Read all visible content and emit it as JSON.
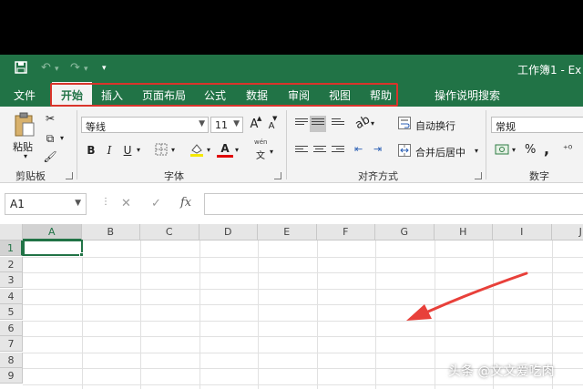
{
  "window": {
    "title": "工作簿1  -  Ex"
  },
  "quick_access": {
    "save_icon": "save-icon",
    "undo_icon": "undo-icon",
    "redo_icon": "redo-icon",
    "customize_icon": "customize-qat-icon"
  },
  "tabs": [
    {
      "label": "文件",
      "active": false
    },
    {
      "label": "开始",
      "active": true
    },
    {
      "label": "插入",
      "active": false
    },
    {
      "label": "页面布局",
      "active": false
    },
    {
      "label": "公式",
      "active": false
    },
    {
      "label": "数据",
      "active": false
    },
    {
      "label": "审阅",
      "active": false
    },
    {
      "label": "视图",
      "active": false
    },
    {
      "label": "帮助",
      "active": false
    }
  ],
  "tell_me": {
    "label": "操作说明搜索",
    "icon": "lightbulb-icon"
  },
  "ribbon": {
    "clipboard": {
      "paste_label": "粘贴",
      "group_label": "剪贴板"
    },
    "font": {
      "font_name": "等线",
      "font_size": "11",
      "bold": "B",
      "italic": "I",
      "underline": "U",
      "grow": "A",
      "shrink": "A",
      "phonetic_top": "wén",
      "phonetic_bottom": "文",
      "font_color_letter": "A",
      "group_label": "字体"
    },
    "alignment": {
      "wrap_text": "自动换行",
      "merge_center": "合并后居中",
      "group_label": "对齐方式"
    },
    "number": {
      "format": "常规",
      "percent": "%",
      "comma": ",",
      "group_label": "数字"
    }
  },
  "formula_bar": {
    "name_box": "A1",
    "cancel": "✕",
    "enter": "✓",
    "fx": "fx",
    "formula": ""
  },
  "grid": {
    "columns": [
      "A",
      "B",
      "C",
      "D",
      "E",
      "F",
      "G",
      "H",
      "I",
      "J"
    ],
    "rows": [
      "1",
      "2",
      "3",
      "4",
      "5",
      "6",
      "7",
      "8",
      "9"
    ],
    "active_cell": "A1"
  },
  "watermark": "头条 @文文爱吃肉",
  "colors": {
    "brand": "#217346",
    "highlight_box": "#d9342b",
    "arrow": "#e8403a"
  }
}
